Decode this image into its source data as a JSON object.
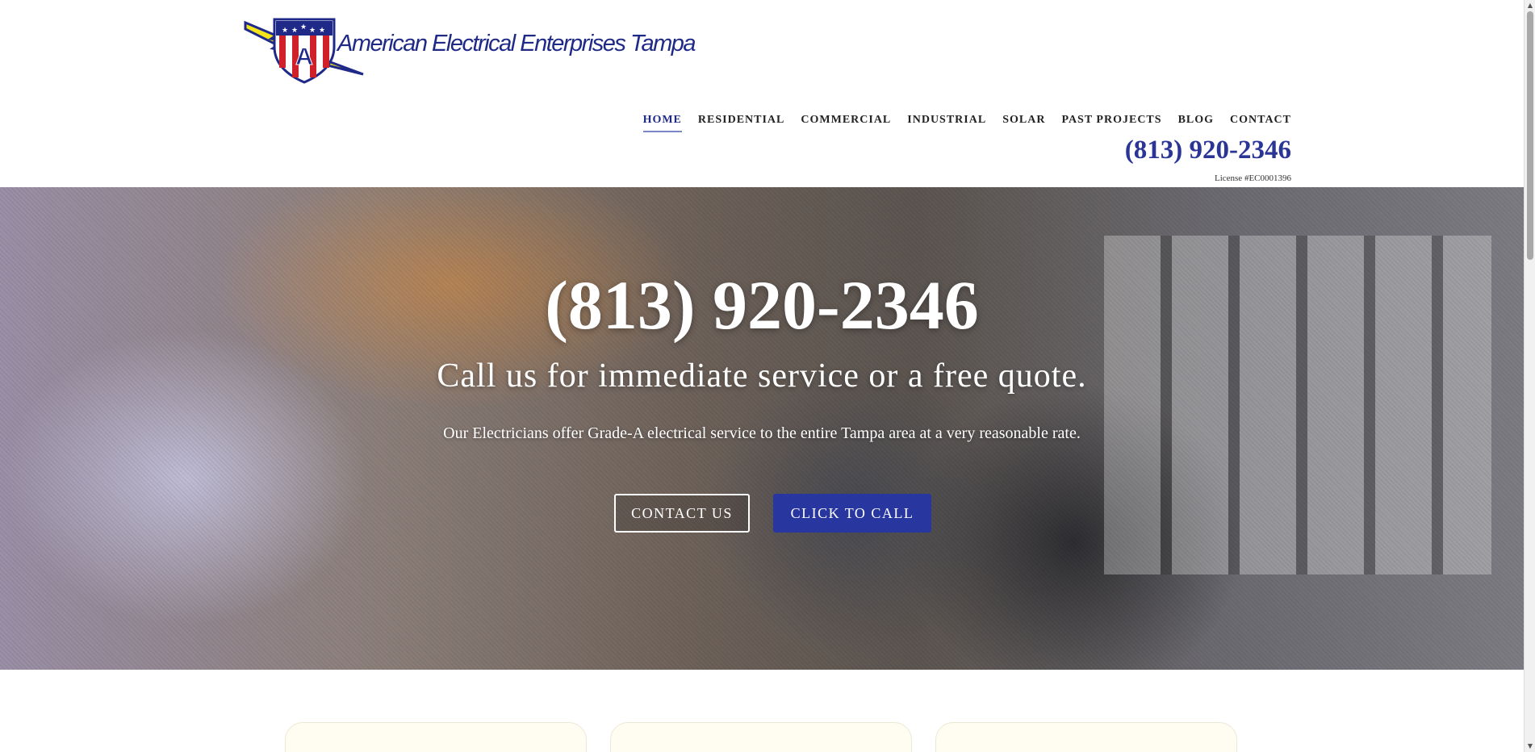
{
  "brand": {
    "name": "American Electrical Enterprises Tampa",
    "logo_letter": "A",
    "colors": {
      "navy": "#1f2a88",
      "red": "#d0202a",
      "yellow": "#f4e41a",
      "accent_blue": "#2836a0"
    }
  },
  "nav": {
    "items": [
      {
        "label": "HOME",
        "active": true
      },
      {
        "label": "RESIDENTIAL"
      },
      {
        "label": "COMMERCIAL"
      },
      {
        "label": "INDUSTRIAL"
      },
      {
        "label": "SOLAR"
      },
      {
        "label": "PAST PROJECTS"
      },
      {
        "label": "BLOG"
      },
      {
        "label": "CONTACT"
      }
    ]
  },
  "header": {
    "phone": "(813) 920-2346",
    "license": "License #EC0001396"
  },
  "hero": {
    "phone": "(813) 920-2346",
    "subtitle": "Call us for immediate service or a free quote.",
    "description": "Our Electricians offer Grade-A electrical service to the entire Tampa area at a very reasonable rate.",
    "buttons": {
      "contact": "CONTACT US",
      "call": "CLICK TO CALL"
    }
  }
}
